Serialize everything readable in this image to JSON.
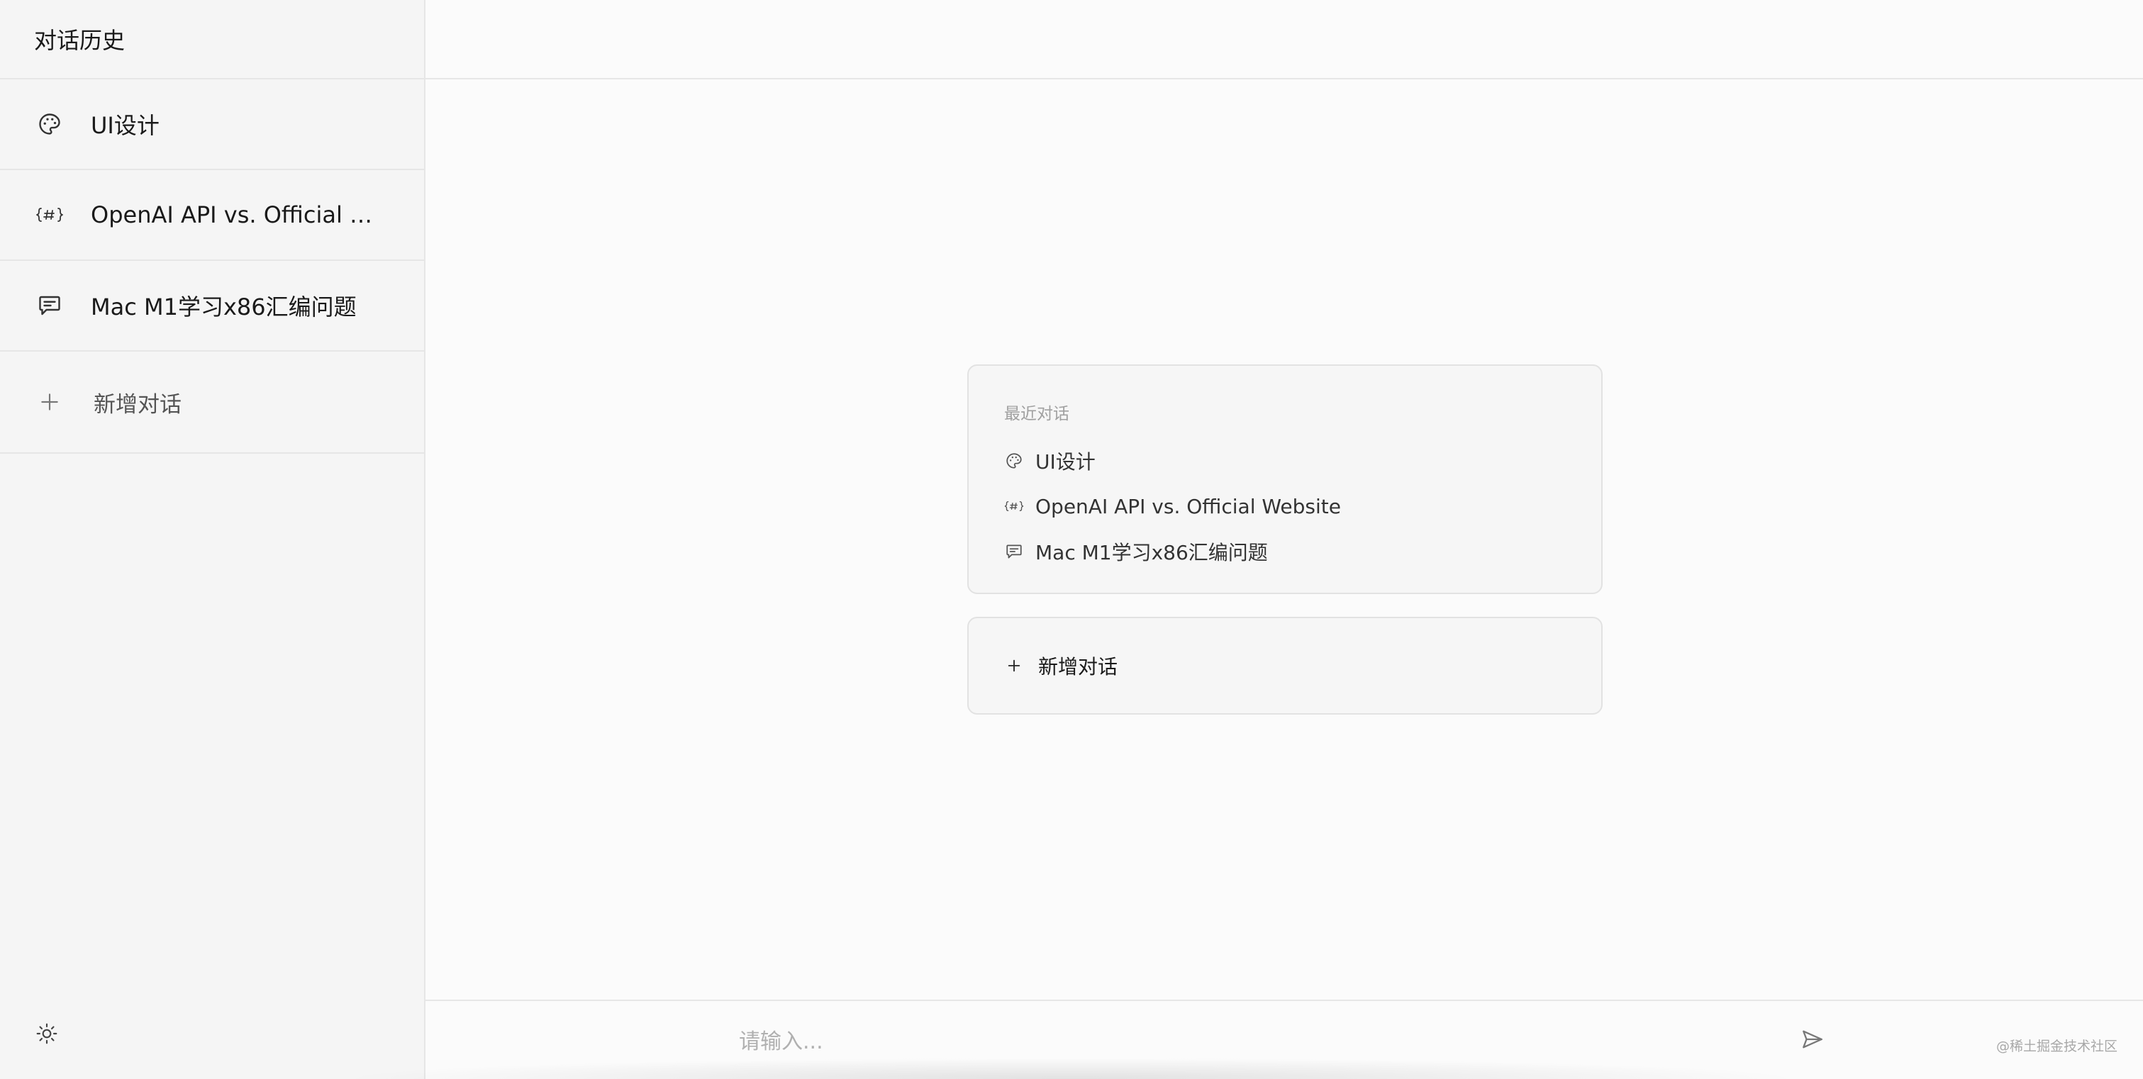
{
  "sidebar": {
    "title": "对话历史",
    "items": [
      {
        "label": "UI设计",
        "icon": "palette-icon"
      },
      {
        "label": "OpenAI API vs. Official Web...",
        "icon": "code-hash-icon"
      },
      {
        "label": "Mac M1学习x86汇编问题",
        "icon": "message-icon"
      }
    ],
    "new_chat_label": "新增对话",
    "theme_icon": "sun-icon"
  },
  "main": {
    "recent": {
      "title": "最近对话",
      "items": [
        {
          "label": "UI设计",
          "icon": "palette-icon"
        },
        {
          "label": "OpenAI API vs. Official Website",
          "icon": "code-hash-icon"
        },
        {
          "label": "Mac M1学习x86汇编问题",
          "icon": "message-icon"
        }
      ]
    },
    "new_chat_label": "新增对话"
  },
  "input": {
    "placeholder": "请输入...",
    "value": "",
    "send_icon": "send-icon"
  },
  "watermark": "@稀土掘金技术社区"
}
